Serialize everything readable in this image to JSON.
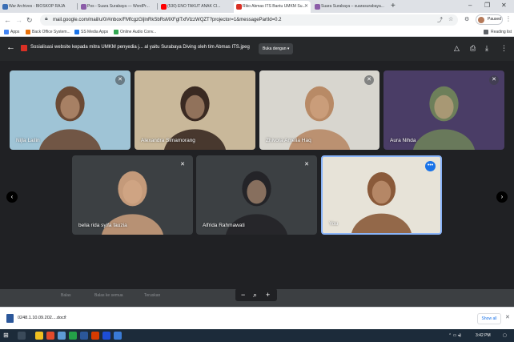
{
  "browser": {
    "tabs": [
      {
        "label": "War Archives - BIOSKOP RAJA",
        "color": "#3b6fb5"
      },
      {
        "label": "Pos - Suara Surabaya — WordPr...",
        "color": "#8b5ca8"
      },
      {
        "label": "(530) ENO TAKUT ANAK CI...",
        "color": "#ff0000"
      },
      {
        "label": "Riko Abmas ITS Bantu UMKM Su...",
        "color": "#d93025"
      },
      {
        "label": "Suara Surabaya – suarasurabaya...",
        "color": "#8b5ca8"
      }
    ],
    "new_tab": "+",
    "window_controls": [
      "–",
      "❐",
      "✕"
    ],
    "url": "mail.google.com/mail/u/0/#inbox/FMfcgzGljlnRkSbRsMXFglTxfVlzzWQZT?projector=1&messagePartId=0.2",
    "profile_label": "Paused",
    "bookmarks": [
      {
        "label": "Apps",
        "color": "#4285f4"
      },
      {
        "label": "Back Office System...",
        "color": "#e8710a"
      },
      {
        "label": "SS Media Apps",
        "color": "#1a73e8"
      },
      {
        "label": "Online Audio Conv...",
        "color": "#34a853"
      }
    ],
    "reading_list": "Reading list"
  },
  "viewer": {
    "title": "Sosialisasi website kepada mitra UMKM penyedia j... al yaitu Surabaya Diving oleh tim Abmas ITS.jpeg",
    "open_with": "Buka dengan",
    "icons": [
      "add-to-drive-icon",
      "print-icon",
      "download-icon",
      "more-icon"
    ]
  },
  "meeting": {
    "participants": [
      {
        "name": "Nijla Lailin",
        "bg": "#9fc4d6",
        "skin": "#6b4a35",
        "muted": true
      },
      {
        "name": "Alexandra Simamorang",
        "bg": "#c9b89a",
        "skin": "#3a2a22",
        "muted": false
      },
      {
        "name": "Zhivora Amelia Haq",
        "bg": "#d8d6cf",
        "skin": "#b88a66",
        "muted": true
      },
      {
        "name": "Aura Nihda",
        "bg": "#4a3d66",
        "skin": "#6d7f5a",
        "muted": true
      },
      {
        "name": "belia rida syifa fauzia",
        "bg": "#3c4043",
        "skin": "#c49a7a",
        "muted": true
      },
      {
        "name": "Alfrida Rahmawati",
        "bg": "#3c4043",
        "skin": "#242428",
        "muted": true
      },
      {
        "name": "You",
        "bg": "#e7e3d8",
        "skin": "#8a5a3a",
        "muted": false
      }
    ],
    "nav_prev": "‹",
    "nav_next": "›"
  },
  "bottom_items": [
    "Balas",
    "Balas ke semua",
    "Teruskan"
  ],
  "zoom": {
    "minus": "−",
    "search": "⌕",
    "plus": "+"
  },
  "downloads": {
    "file": "0248.1.10.09.202....docx",
    "show_all": "Show all"
  },
  "taskbar": {
    "time": "3:42 PM",
    "apps": [
      "#f0c020",
      "#e34b2c",
      "#5e9bd6",
      "#24a148",
      "#2b579a",
      "#d83b01",
      "#1d4ed8",
      "#3a7bd5"
    ]
  }
}
